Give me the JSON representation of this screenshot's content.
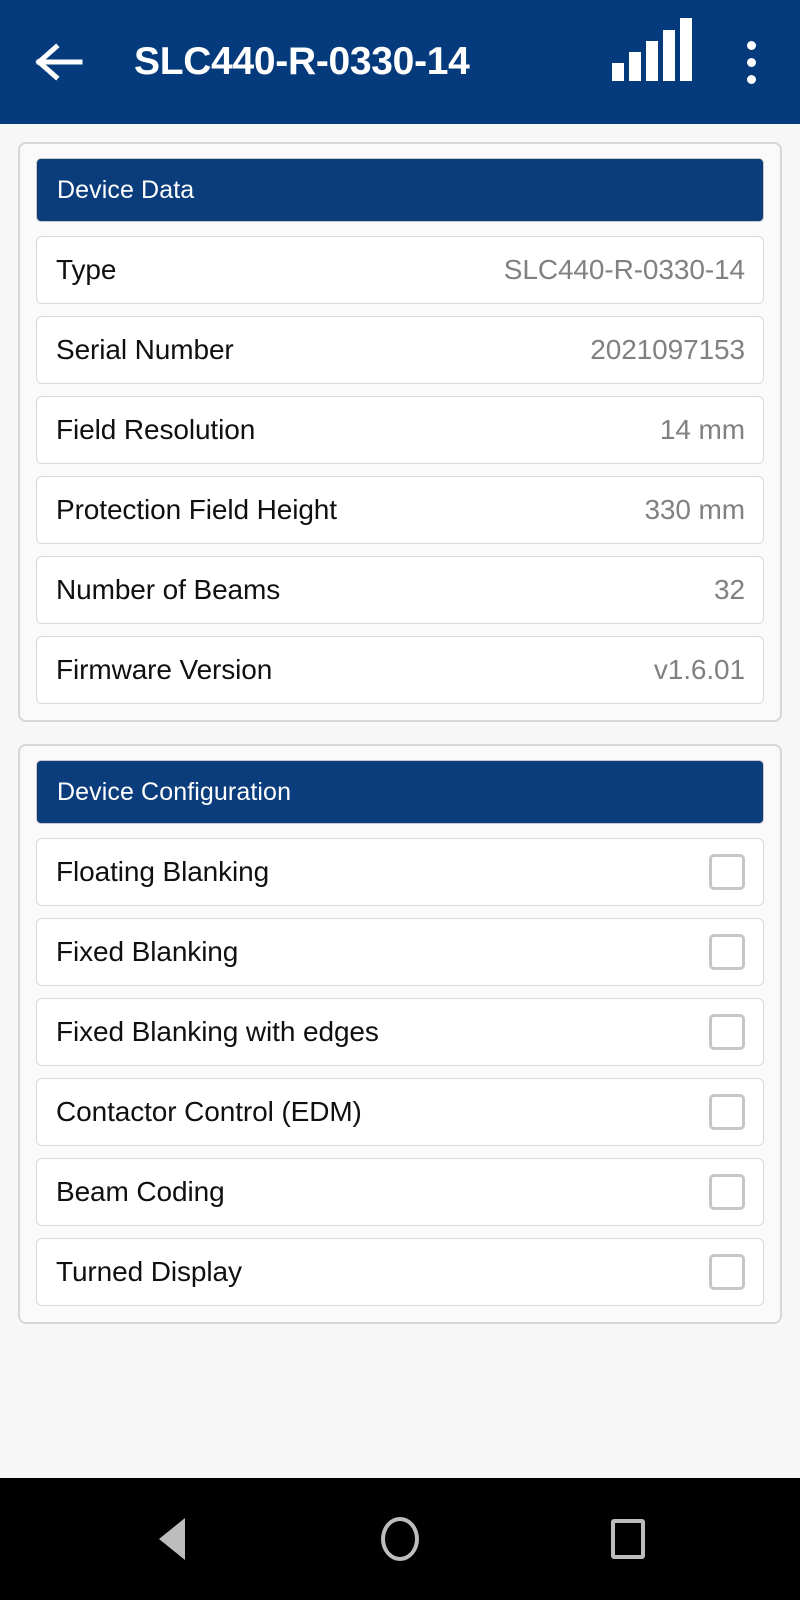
{
  "appbar": {
    "back_icon": "back-arrow-icon",
    "title": "SLC440-R-0330-14",
    "signal_icon": "signal-bars-icon",
    "signal_bars_filled": 5,
    "overflow_icon": "overflow-menu-icon",
    "background_color": "#053B7C"
  },
  "sections": [
    {
      "header": "Device Data",
      "type": "key-value",
      "rows": [
        {
          "label": "Type",
          "value": "SLC440-R-0330-14"
        },
        {
          "label": "Serial Number",
          "value": "2021097153"
        },
        {
          "label": "Field Resolution",
          "value": "14 mm"
        },
        {
          "label": "Protection Field Height",
          "value": "330 mm"
        },
        {
          "label": "Number of Beams",
          "value": "32"
        },
        {
          "label": "Firmware Version",
          "value": "v1.6.01"
        }
      ]
    },
    {
      "header": "Device Configuration",
      "type": "checkbox",
      "rows": [
        {
          "label": "Floating Blanking",
          "checked": false
        },
        {
          "label": "Fixed Blanking",
          "checked": false
        },
        {
          "label": "Fixed Blanking with edges",
          "checked": false
        },
        {
          "label": "Contactor Control (EDM)",
          "checked": false
        },
        {
          "label": "Beam Coding",
          "checked": false
        },
        {
          "label": "Turned Display",
          "checked": false
        }
      ]
    }
  ],
  "navbar": {
    "back_icon": "nav-back-triangle-icon",
    "home_icon": "nav-home-circle-icon",
    "recents_icon": "nav-recents-square-icon"
  },
  "colors": {
    "header_blue": "#0B3D7D",
    "appbar_blue": "#053B7C",
    "page_background": "#f7f7f7",
    "value_gray": "#818181",
    "label_black": "#101010",
    "border_gray": "#d9d9d9",
    "checkbox_gray": "#c6c6c6"
  }
}
